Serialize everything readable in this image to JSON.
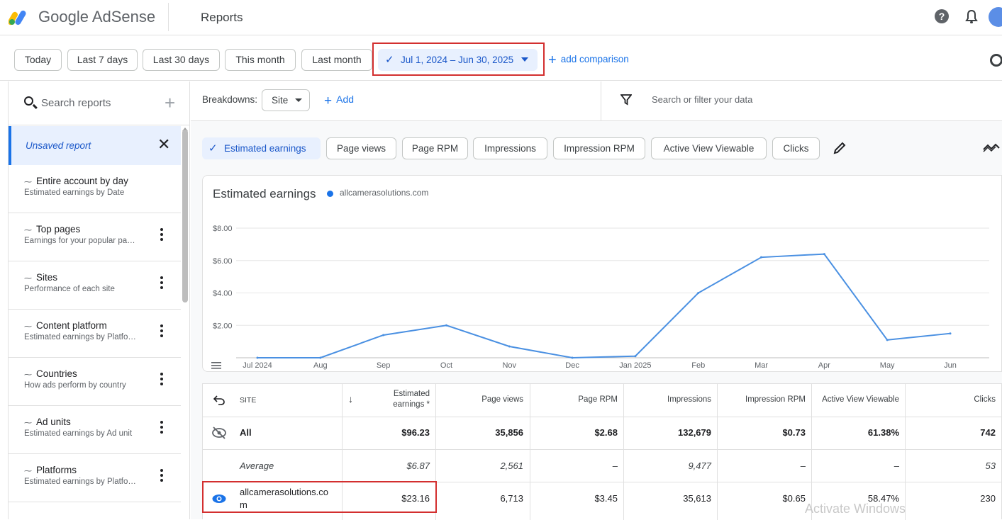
{
  "header": {
    "brand": "Google AdSense",
    "page_title": "Reports"
  },
  "date_chips": [
    "Today",
    "Last 7 days",
    "Last 30 days",
    "This month",
    "Last month"
  ],
  "date_range": "Jul 1, 2024 – Jun 30, 2025",
  "add_comparison": "add comparison",
  "sidebar": {
    "search_label": "Search reports",
    "unsaved": "Unsaved report",
    "items": [
      {
        "title": "Entire account by day",
        "subtitle": "Estimated earnings by Date"
      },
      {
        "title": "Top pages",
        "subtitle": "Earnings for your popular pa…"
      },
      {
        "title": "Sites",
        "subtitle": "Performance of each site"
      },
      {
        "title": "Content platform",
        "subtitle": "Estimated earnings by Platfo…"
      },
      {
        "title": "Countries",
        "subtitle": "How ads perform by country"
      },
      {
        "title": "Ad units",
        "subtitle": "Estimated earnings by Ad unit"
      },
      {
        "title": "Platforms",
        "subtitle": "Estimated earnings by Platfo…"
      }
    ]
  },
  "breakdowns": {
    "label": "Breakdowns:",
    "site": "Site",
    "add": "Add",
    "filter_placeholder": "Search or filter your data"
  },
  "metric_chips": [
    "Page views",
    "Page RPM",
    "Impressions",
    "Impression RPM",
    "Active View Viewable",
    "Clicks"
  ],
  "metric_selected": "Estimated earnings",
  "chart_data": {
    "type": "line",
    "title": "Estimated earnings",
    "legend": "allcamerasolutions.com",
    "x": [
      "Jul 2024",
      "Aug",
      "Sep",
      "Oct",
      "Nov",
      "Dec",
      "Jan 2025",
      "Feb",
      "Mar",
      "Apr",
      "May",
      "Jun"
    ],
    "series": [
      {
        "name": "allcamerasolutions.com",
        "values": [
          0.0,
          0.0,
          1.4,
          2.0,
          0.7,
          0.0,
          0.1,
          4.0,
          6.2,
          6.4,
          1.1,
          1.5
        ]
      }
    ],
    "ylim": [
      0,
      8
    ],
    "yticks": [
      "$8.00",
      "$6.00",
      "$4.00",
      "$2.00"
    ],
    "color": "#4a90e2",
    "grid": true
  },
  "table": {
    "headers": {
      "site": "SITE",
      "earnings_1": "Estimated",
      "earnings_2": "earnings *",
      "page_views": "Page views",
      "page_rpm": "Page RPM",
      "impressions": "Impressions",
      "impression_rpm": "Impression RPM",
      "active_view": "Active View Viewable",
      "clicks": "Clicks"
    },
    "all": {
      "label": "All",
      "earnings": "$96.23",
      "page_views": "35,856",
      "page_rpm": "$2.68",
      "impressions": "132,679",
      "impression_rpm": "$0.73",
      "active_view": "61.38%",
      "clicks": "742"
    },
    "average": {
      "label": "Average",
      "earnings": "$6.87",
      "page_views": "2,561",
      "page_rpm": "–",
      "impressions": "9,477",
      "impression_rpm": "–",
      "active_view": "–",
      "clicks": "53"
    },
    "site_row": {
      "label_1": "allcamerasolutions.co",
      "label_2": "m",
      "earnings": "$23.16",
      "page_views": "6,713",
      "page_rpm": "$3.45",
      "impressions": "35,613",
      "impression_rpm": "$0.65",
      "active_view": "58.47%",
      "clicks": "230"
    }
  },
  "watermark": "Activate Windows"
}
